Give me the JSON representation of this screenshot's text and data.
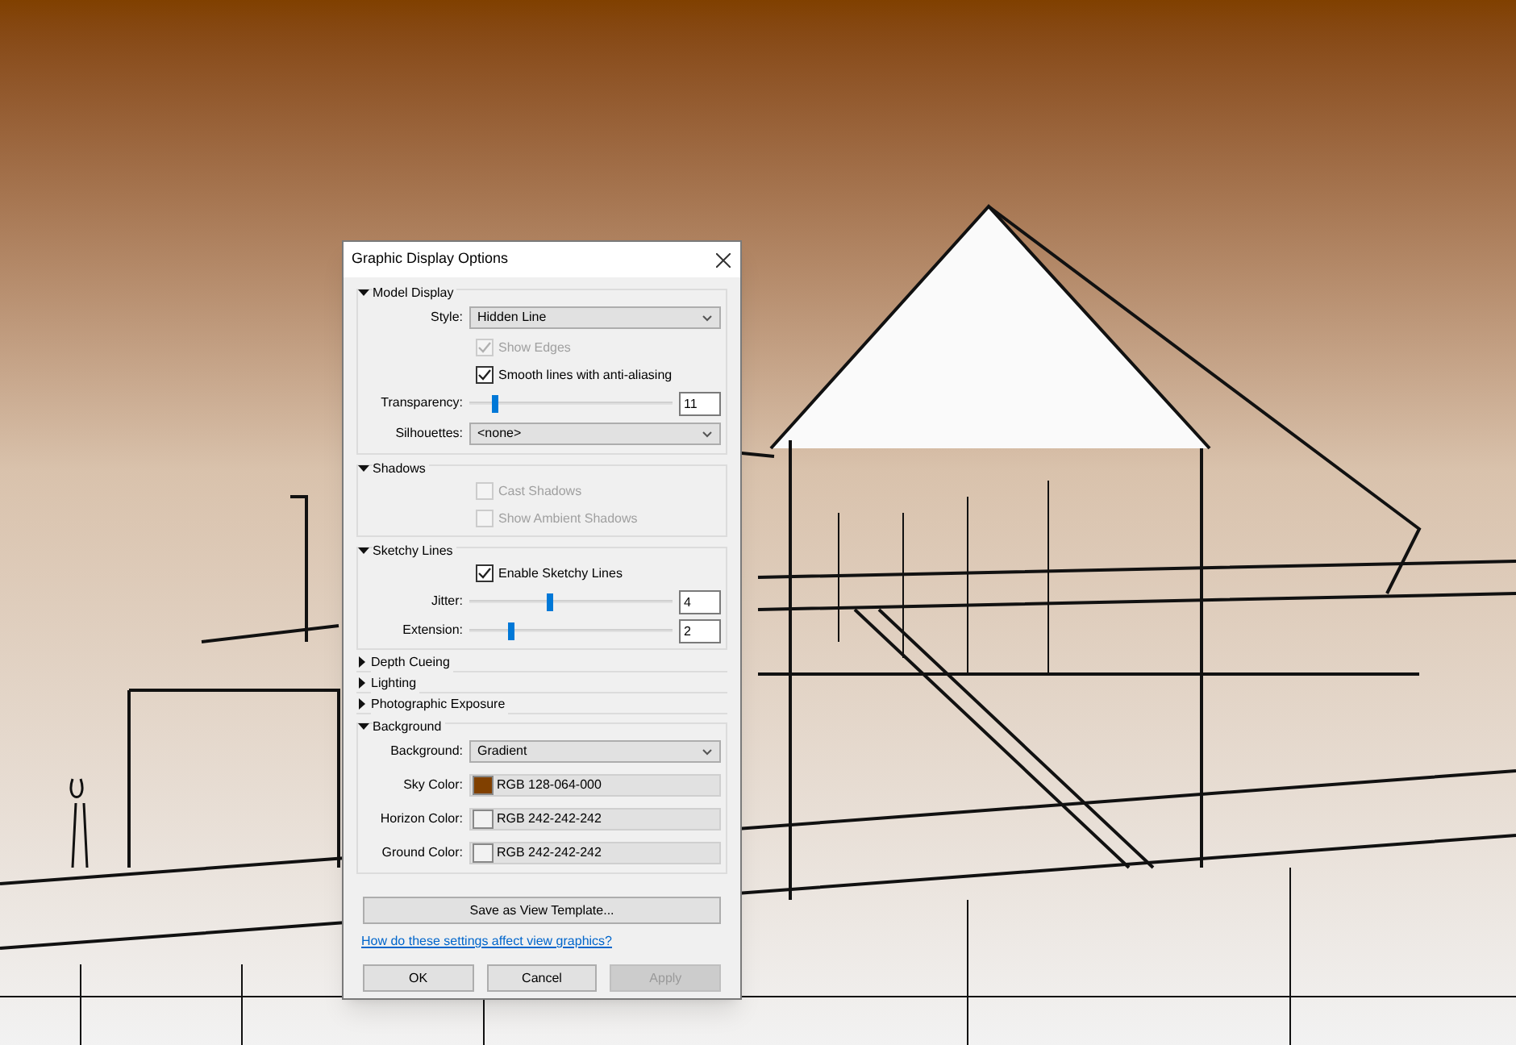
{
  "dialog": {
    "title": "Graphic Display Options",
    "sections": [
      {
        "title": "Model Display",
        "expanded": true,
        "rows": [
          {
            "kind": "select",
            "label": "Style:",
            "value": "Hidden Line"
          },
          {
            "kind": "checkbox",
            "label": "Show Edges",
            "checked": true,
            "disabled": true
          },
          {
            "kind": "checkbox",
            "label": "Smooth lines with anti-aliasing",
            "checked": true,
            "disabled": false
          },
          {
            "kind": "slider",
            "label": "Transparency:",
            "level": 0.13,
            "value": "11"
          },
          {
            "kind": "select",
            "label": "Silhouettes:",
            "value": "<none>"
          }
        ]
      },
      {
        "title": "Shadows",
        "expanded": true,
        "rows": [
          {
            "kind": "checkbox",
            "label": "Cast Shadows",
            "checked": false,
            "disabled": true
          },
          {
            "kind": "checkbox",
            "label": "Show Ambient Shadows",
            "checked": false,
            "disabled": true
          }
        ]
      },
      {
        "title": "Sketchy Lines",
        "expanded": true,
        "rows": [
          {
            "kind": "checkbox",
            "label": "Enable Sketchy Lines",
            "checked": true,
            "disabled": false
          },
          {
            "kind": "slider",
            "label": "Jitter:",
            "level": 0.4,
            "value": "4"
          },
          {
            "kind": "slider",
            "label": "Extension:",
            "level": 0.21,
            "value": "2"
          }
        ]
      },
      {
        "title": "Depth Cueing",
        "expanded": false
      },
      {
        "title": "Lighting",
        "expanded": false
      },
      {
        "title": "Photographic Exposure",
        "expanded": false
      },
      {
        "title": "Background",
        "expanded": true,
        "rows": [
          {
            "kind": "select",
            "label": "Background:",
            "value": "Gradient"
          },
          {
            "kind": "color",
            "label": "Sky Color:",
            "value": "RGB 128-064-000",
            "color": "#804000"
          },
          {
            "kind": "color",
            "label": "Horizon Color:",
            "value": "RGB 242-242-242",
            "color": "#f2f2f2"
          },
          {
            "kind": "color",
            "label": "Ground Color:",
            "value": "RGB 242-242-242",
            "color": "#f2f2f2"
          }
        ]
      }
    ],
    "template_button": "Save as View Template...",
    "help_link": "How do these settings affect view graphics?",
    "buttons": [
      {
        "label": "OK",
        "disabled": false
      },
      {
        "label": "Cancel",
        "disabled": false
      },
      {
        "label": "Apply",
        "disabled": true
      }
    ]
  }
}
